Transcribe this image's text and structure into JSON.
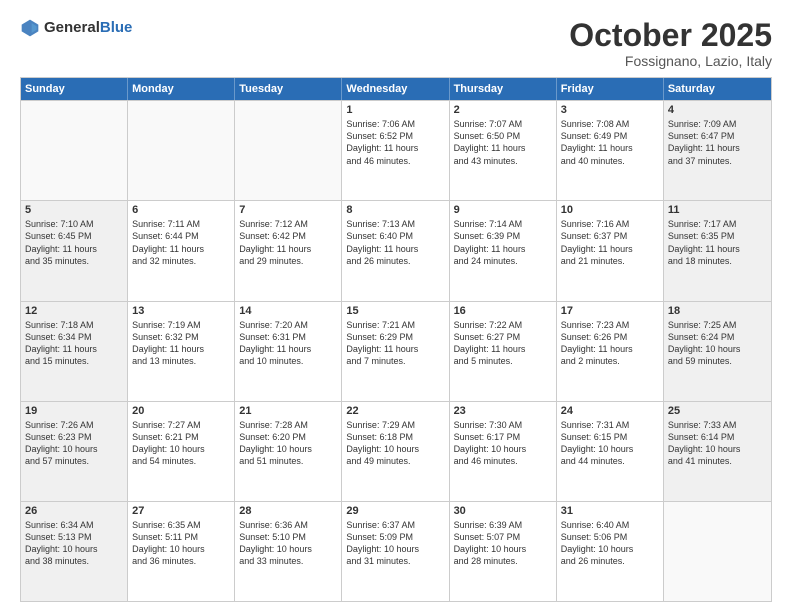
{
  "header": {
    "logo_general": "General",
    "logo_blue": "Blue",
    "month": "October 2025",
    "location": "Fossignano, Lazio, Italy"
  },
  "weekdays": [
    "Sunday",
    "Monday",
    "Tuesday",
    "Wednesday",
    "Thursday",
    "Friday",
    "Saturday"
  ],
  "rows": [
    [
      {
        "day": "",
        "text": "",
        "empty": true
      },
      {
        "day": "",
        "text": "",
        "empty": true
      },
      {
        "day": "",
        "text": "",
        "empty": true
      },
      {
        "day": "1",
        "text": "Sunrise: 7:06 AM\nSunset: 6:52 PM\nDaylight: 11 hours\nand 46 minutes.",
        "empty": false
      },
      {
        "day": "2",
        "text": "Sunrise: 7:07 AM\nSunset: 6:50 PM\nDaylight: 11 hours\nand 43 minutes.",
        "empty": false
      },
      {
        "day": "3",
        "text": "Sunrise: 7:08 AM\nSunset: 6:49 PM\nDaylight: 11 hours\nand 40 minutes.",
        "empty": false
      },
      {
        "day": "4",
        "text": "Sunrise: 7:09 AM\nSunset: 6:47 PM\nDaylight: 11 hours\nand 37 minutes.",
        "empty": false,
        "shaded": true
      }
    ],
    [
      {
        "day": "5",
        "text": "Sunrise: 7:10 AM\nSunset: 6:45 PM\nDaylight: 11 hours\nand 35 minutes.",
        "empty": false,
        "shaded": true
      },
      {
        "day": "6",
        "text": "Sunrise: 7:11 AM\nSunset: 6:44 PM\nDaylight: 11 hours\nand 32 minutes.",
        "empty": false
      },
      {
        "day": "7",
        "text": "Sunrise: 7:12 AM\nSunset: 6:42 PM\nDaylight: 11 hours\nand 29 minutes.",
        "empty": false
      },
      {
        "day": "8",
        "text": "Sunrise: 7:13 AM\nSunset: 6:40 PM\nDaylight: 11 hours\nand 26 minutes.",
        "empty": false
      },
      {
        "day": "9",
        "text": "Sunrise: 7:14 AM\nSunset: 6:39 PM\nDaylight: 11 hours\nand 24 minutes.",
        "empty": false
      },
      {
        "day": "10",
        "text": "Sunrise: 7:16 AM\nSunset: 6:37 PM\nDaylight: 11 hours\nand 21 minutes.",
        "empty": false
      },
      {
        "day": "11",
        "text": "Sunrise: 7:17 AM\nSunset: 6:35 PM\nDaylight: 11 hours\nand 18 minutes.",
        "empty": false,
        "shaded": true
      }
    ],
    [
      {
        "day": "12",
        "text": "Sunrise: 7:18 AM\nSunset: 6:34 PM\nDaylight: 11 hours\nand 15 minutes.",
        "empty": false,
        "shaded": true
      },
      {
        "day": "13",
        "text": "Sunrise: 7:19 AM\nSunset: 6:32 PM\nDaylight: 11 hours\nand 13 minutes.",
        "empty": false
      },
      {
        "day": "14",
        "text": "Sunrise: 7:20 AM\nSunset: 6:31 PM\nDaylight: 11 hours\nand 10 minutes.",
        "empty": false
      },
      {
        "day": "15",
        "text": "Sunrise: 7:21 AM\nSunset: 6:29 PM\nDaylight: 11 hours\nand 7 minutes.",
        "empty": false
      },
      {
        "day": "16",
        "text": "Sunrise: 7:22 AM\nSunset: 6:27 PM\nDaylight: 11 hours\nand 5 minutes.",
        "empty": false
      },
      {
        "day": "17",
        "text": "Sunrise: 7:23 AM\nSunset: 6:26 PM\nDaylight: 11 hours\nand 2 minutes.",
        "empty": false
      },
      {
        "day": "18",
        "text": "Sunrise: 7:25 AM\nSunset: 6:24 PM\nDaylight: 10 hours\nand 59 minutes.",
        "empty": false,
        "shaded": true
      }
    ],
    [
      {
        "day": "19",
        "text": "Sunrise: 7:26 AM\nSunset: 6:23 PM\nDaylight: 10 hours\nand 57 minutes.",
        "empty": false,
        "shaded": true
      },
      {
        "day": "20",
        "text": "Sunrise: 7:27 AM\nSunset: 6:21 PM\nDaylight: 10 hours\nand 54 minutes.",
        "empty": false
      },
      {
        "day": "21",
        "text": "Sunrise: 7:28 AM\nSunset: 6:20 PM\nDaylight: 10 hours\nand 51 minutes.",
        "empty": false
      },
      {
        "day": "22",
        "text": "Sunrise: 7:29 AM\nSunset: 6:18 PM\nDaylight: 10 hours\nand 49 minutes.",
        "empty": false
      },
      {
        "day": "23",
        "text": "Sunrise: 7:30 AM\nSunset: 6:17 PM\nDaylight: 10 hours\nand 46 minutes.",
        "empty": false
      },
      {
        "day": "24",
        "text": "Sunrise: 7:31 AM\nSunset: 6:15 PM\nDaylight: 10 hours\nand 44 minutes.",
        "empty": false
      },
      {
        "day": "25",
        "text": "Sunrise: 7:33 AM\nSunset: 6:14 PM\nDaylight: 10 hours\nand 41 minutes.",
        "empty": false,
        "shaded": true
      }
    ],
    [
      {
        "day": "26",
        "text": "Sunrise: 6:34 AM\nSunset: 5:13 PM\nDaylight: 10 hours\nand 38 minutes.",
        "empty": false,
        "shaded": true
      },
      {
        "day": "27",
        "text": "Sunrise: 6:35 AM\nSunset: 5:11 PM\nDaylight: 10 hours\nand 36 minutes.",
        "empty": false
      },
      {
        "day": "28",
        "text": "Sunrise: 6:36 AM\nSunset: 5:10 PM\nDaylight: 10 hours\nand 33 minutes.",
        "empty": false
      },
      {
        "day": "29",
        "text": "Sunrise: 6:37 AM\nSunset: 5:09 PM\nDaylight: 10 hours\nand 31 minutes.",
        "empty": false
      },
      {
        "day": "30",
        "text": "Sunrise: 6:39 AM\nSunset: 5:07 PM\nDaylight: 10 hours\nand 28 minutes.",
        "empty": false
      },
      {
        "day": "31",
        "text": "Sunrise: 6:40 AM\nSunset: 5:06 PM\nDaylight: 10 hours\nand 26 minutes.",
        "empty": false
      },
      {
        "day": "",
        "text": "",
        "empty": true
      }
    ]
  ]
}
